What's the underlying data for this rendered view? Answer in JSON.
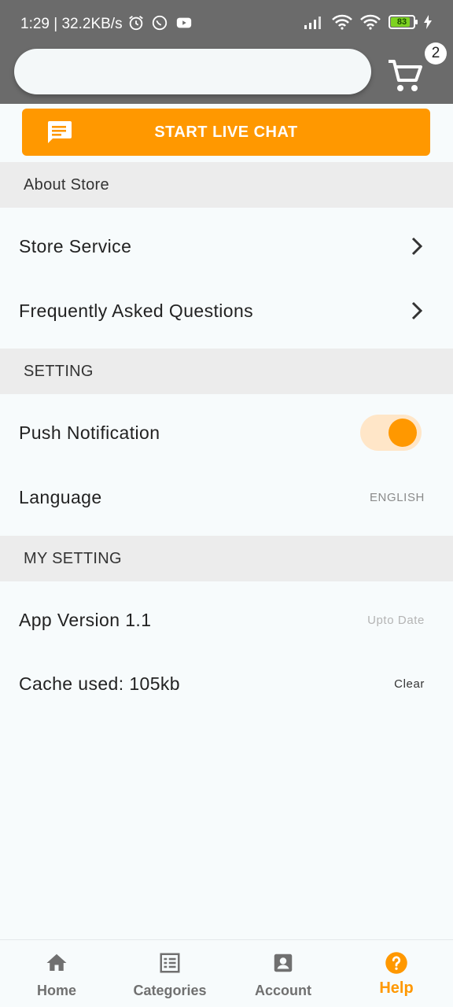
{
  "status_bar": {
    "time_speed": "1:29 | 32.2KB/s",
    "battery": "83",
    "icons": [
      "alarm-icon",
      "whatsapp-icon",
      "youtube-icon",
      "signal-icon",
      "wifi-icon",
      "wifi-icon",
      "battery-icon",
      "charging-icon"
    ]
  },
  "header": {
    "search_placeholder": "",
    "cart_count": "2"
  },
  "live_chat": {
    "label": "START LIVE CHAT"
  },
  "sections": {
    "about": {
      "title": "About Store",
      "items": [
        "Store Service",
        "Frequently Asked Questions"
      ]
    },
    "setting": {
      "title": "SETTING",
      "push_label": "Push Notification",
      "push_enabled": true,
      "language_label": "Language",
      "language_value": "ENGLISH"
    },
    "my_setting": {
      "title": "MY SETTING",
      "version_label": "App Version 1.1",
      "version_status": "Upto Date",
      "cache_label": "Cache used: 105kb",
      "cache_action": "Clear"
    }
  },
  "bottom_nav": {
    "items": [
      {
        "label": "Home",
        "icon": "home-icon"
      },
      {
        "label": "Categories",
        "icon": "list-icon"
      },
      {
        "label": "Account",
        "icon": "account-icon"
      },
      {
        "label": "Help",
        "icon": "help-icon"
      }
    ],
    "active": "Help"
  },
  "colors": {
    "accent": "#ff9800",
    "header_bg": "#6b6b6b",
    "section_bg": "#ececec",
    "page_bg": "#f7fbfc"
  }
}
